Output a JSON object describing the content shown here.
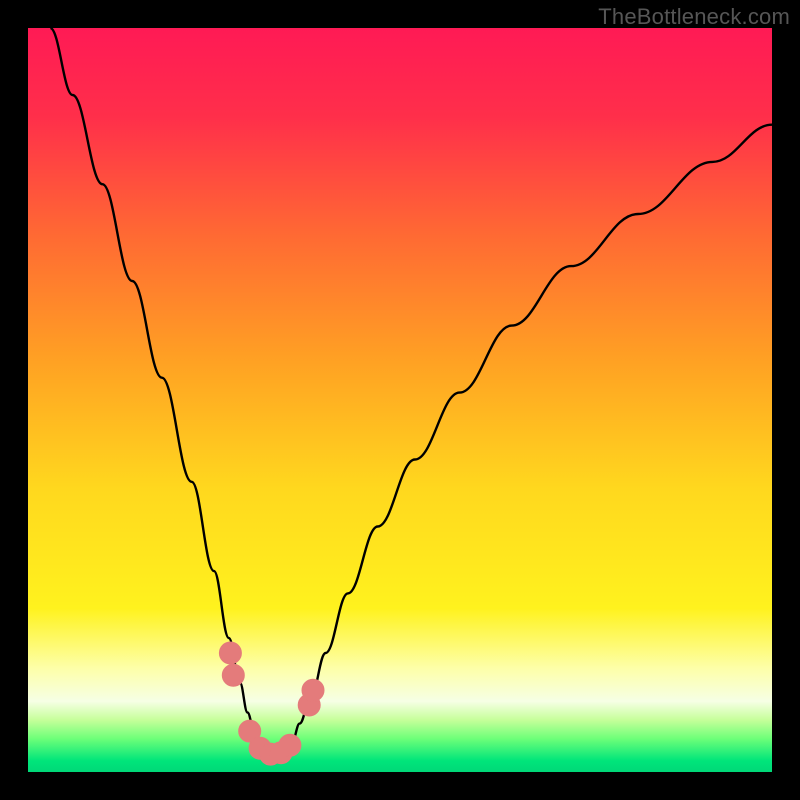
{
  "attribution": {
    "watermark": "TheBottleneck.com"
  },
  "colors": {
    "frame": "#000000",
    "gradient_stops": [
      {
        "offset": 0.0,
        "color": "#ff1a55"
      },
      {
        "offset": 0.12,
        "color": "#ff2f4a"
      },
      {
        "offset": 0.28,
        "color": "#ff6a33"
      },
      {
        "offset": 0.45,
        "color": "#ffa223"
      },
      {
        "offset": 0.62,
        "color": "#ffd81e"
      },
      {
        "offset": 0.78,
        "color": "#fff21e"
      },
      {
        "offset": 0.86,
        "color": "#fdffa8"
      },
      {
        "offset": 0.905,
        "color": "#f6ffe5"
      },
      {
        "offset": 0.93,
        "color": "#c6ff9a"
      },
      {
        "offset": 0.955,
        "color": "#6eff79"
      },
      {
        "offset": 0.985,
        "color": "#00e57a"
      },
      {
        "offset": 1.0,
        "color": "#00d878"
      }
    ],
    "curve": "#000000",
    "dot_fill": "#e47b7b",
    "dot_stroke": "#e47b7b"
  },
  "chart_data": {
    "type": "line",
    "title": "",
    "xlabel": "",
    "ylabel": "",
    "xrange": [
      0,
      100
    ],
    "yrange": [
      0,
      100
    ],
    "note": "V-shaped bottleneck curve; y≈100 at edges dipping to ≈0 near x≈33. Values estimated from pixel positions (no axis ticks visible).",
    "series": [
      {
        "name": "bottleneck-curve",
        "x": [
          3,
          6,
          10,
          14,
          18,
          22,
          25,
          27,
          28.5,
          29.5,
          30.5,
          31.8,
          33,
          34.2,
          35.5,
          36.5,
          38,
          40,
          43,
          47,
          52,
          58,
          65,
          73,
          82,
          92,
          100
        ],
        "y": [
          100,
          91,
          79,
          66,
          53,
          39,
          27,
          18,
          12,
          8,
          5,
          3,
          2.2,
          2.6,
          4,
          6.5,
          10,
          16,
          24,
          33,
          42,
          51,
          60,
          68,
          75,
          82,
          87
        ]
      }
    ],
    "highlight_points": [
      {
        "x": 27.2,
        "y": 16
      },
      {
        "x": 27.6,
        "y": 13
      },
      {
        "x": 29.8,
        "y": 5.5
      },
      {
        "x": 31.2,
        "y": 3.2
      },
      {
        "x": 32.6,
        "y": 2.4
      },
      {
        "x": 34.0,
        "y": 2.6
      },
      {
        "x": 35.2,
        "y": 3.6
      },
      {
        "x": 37.8,
        "y": 9
      },
      {
        "x": 38.3,
        "y": 11
      }
    ]
  }
}
